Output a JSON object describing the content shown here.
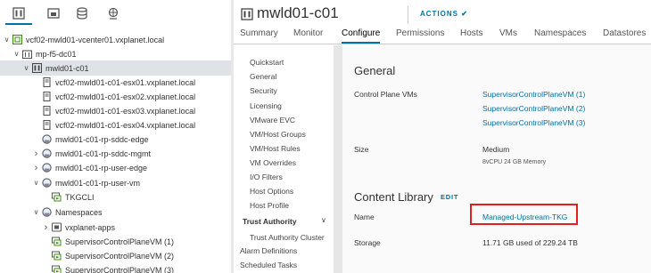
{
  "navigator": {
    "tabs": [
      {
        "name": "hosts-and-clusters",
        "icon": "hosts-clusters-icon"
      },
      {
        "name": "vms-and-templates",
        "icon": "vms-templates-icon"
      },
      {
        "name": "storage",
        "icon": "storage-icon"
      },
      {
        "name": "networking",
        "icon": "networking-icon"
      }
    ],
    "tree": [
      {
        "label": "vcf02-mwld01-vcenter01.vxplanet.local",
        "icon": "vcenter-icon",
        "caret": "down"
      },
      {
        "label": "mp-f5-dc01",
        "icon": "datacenter-icon",
        "caret": "down"
      },
      {
        "label": "mwld01-c01",
        "icon": "cluster-icon",
        "caret": "down",
        "selected": true
      },
      {
        "label": "vcf02-mwld01-c01-esx01.vxplanet.local",
        "icon": "host-icon",
        "caret": ""
      },
      {
        "label": "vcf02-mwld01-c01-esx02.vxplanet.local",
        "icon": "host-icon",
        "caret": ""
      },
      {
        "label": "vcf02-mwld01-c01-esx03.vxplanet.local",
        "icon": "host-icon",
        "caret": ""
      },
      {
        "label": "vcf02-mwld01-c01-esx04.vxplanet.local",
        "icon": "host-icon",
        "caret": ""
      },
      {
        "label": "mwld01-c01-rp-sddc-edge",
        "icon": "resource-pool-icon",
        "caret": ""
      },
      {
        "label": "mwld01-c01-rp-sddc-mgmt",
        "icon": "resource-pool-icon",
        "caret": "right"
      },
      {
        "label": "mwld01-c01-rp-user-edge",
        "icon": "resource-pool-icon",
        "caret": "right"
      },
      {
        "label": "mwld01-c01-rp-user-vm",
        "icon": "resource-pool-icon",
        "caret": "down"
      },
      {
        "label": "TKGCLI",
        "icon": "vm-icon",
        "caret": ""
      },
      {
        "label": "Namespaces",
        "icon": "resource-pool-icon",
        "caret": "down"
      },
      {
        "label": "vxplanet-apps",
        "icon": "namespace-icon",
        "caret": "right"
      },
      {
        "label": "SupervisorControlPlaneVM (1)",
        "icon": "vm-icon",
        "caret": ""
      },
      {
        "label": "SupervisorControlPlaneVM (2)",
        "icon": "vm-icon",
        "caret": ""
      },
      {
        "label": "SupervisorControlPlaneVM (3)",
        "icon": "vm-icon",
        "caret": ""
      }
    ]
  },
  "header": {
    "title": "mwld01-c01",
    "actions_label": "ACTIONS ✔",
    "title_icon": "cluster-icon"
  },
  "tabs": [
    {
      "label": "Summary",
      "active": false
    },
    {
      "label": "Monitor",
      "active": false
    },
    {
      "label": "Configure",
      "active": true
    },
    {
      "label": "Permissions",
      "active": false
    },
    {
      "label": "Hosts",
      "active": false
    },
    {
      "label": "VMs",
      "active": false
    },
    {
      "label": "Namespaces",
      "active": false
    },
    {
      "label": "Datastores",
      "active": false
    }
  ],
  "subnav": {
    "items": [
      "Quickstart",
      "General",
      "Security",
      "Licensing",
      "VMware EVC",
      "VM/Host Groups",
      "VM/Host Rules",
      "VM Overrides",
      "I/O Filters",
      "Host Options",
      "Host Profile"
    ],
    "trust_authority": "Trust Authority",
    "trust_authority_cluster": "Trust Authority Cluster",
    "alarm_definitions": "Alarm Definitions",
    "scheduled_tasks": "Scheduled Tasks"
  },
  "general": {
    "title": "General",
    "control_plane_label": "Control Plane VMs",
    "control_plane_vms": [
      "SupervisorControlPlaneVM (1)",
      "SupervisorControlPlaneVM (2)",
      "SupervisorControlPlaneVM (3)"
    ],
    "size_label": "Size",
    "size_value": "Medium",
    "size_detail": "8vCPU 24 GB Memory"
  },
  "content_library": {
    "title": "Content Library",
    "edit_label": "EDIT",
    "name_label": "Name",
    "name_value": "Managed-Upstream-TKG",
    "storage_label": "Storage",
    "storage_value": "11.71 GB used of 229.24 TB"
  },
  "colors": {
    "accent": "#0072a3",
    "selection": "#dfe3e8",
    "highlight_box": "#e02020"
  }
}
